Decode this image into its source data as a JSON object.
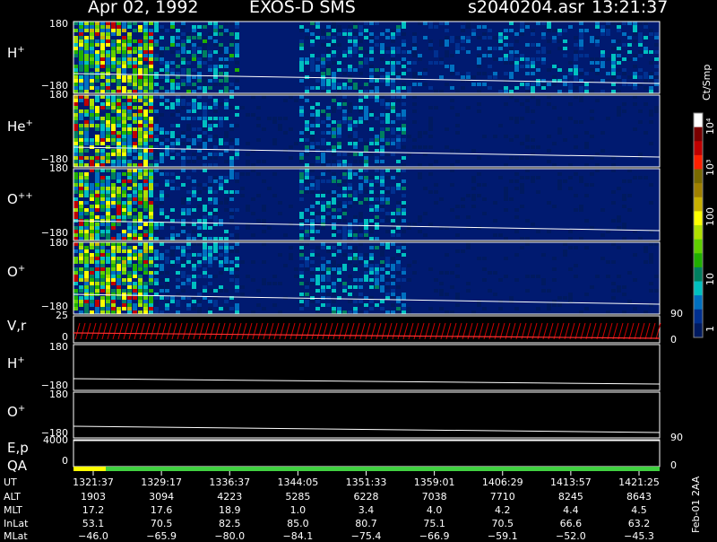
{
  "header": {
    "date": "Apr 02, 1992",
    "instrument": "EXOS-D SMS",
    "file": "s2040204.asr",
    "time": "13:21:37"
  },
  "panels": [
    {
      "label": "H",
      "sup": "+",
      "ytop": "180",
      "ybot": "−180"
    },
    {
      "label": "He",
      "sup": "+",
      "ytop": "180",
      "ybot": "−180"
    },
    {
      "label": "O",
      "sup": "++",
      "ytop": "180",
      "ybot": "−180"
    },
    {
      "label": "O",
      "sup": "+",
      "ytop": "180",
      "ybot": "−180"
    }
  ],
  "vr_panel": {
    "label": "V,r",
    "ytop": "25",
    "ybot": "0",
    "rtop": "90",
    "rbot": "0"
  },
  "h_line_panel": {
    "label": "H",
    "sup": "+",
    "ytop": "180",
    "ybot": "−180"
  },
  "o_line_panel": {
    "label": "O",
    "sup": "+",
    "ytop": "180",
    "ybot": "−180"
  },
  "ep_panel": {
    "label": "E,p",
    "ytop": "4000",
    "rtop": "90"
  },
  "qa_panel": {
    "label": "QA",
    "ybot": "0",
    "rbot": "0"
  },
  "colorbar": {
    "unit": "Ct/Smp",
    "ticks": [
      "10⁴",
      "10³",
      "100",
      "10",
      "1"
    ],
    "colors": [
      "#ffffff",
      "#7a0000",
      "#c00000",
      "#ff2000",
      "#7a6a00",
      "#a08000",
      "#c8b000",
      "#ffff00",
      "#b0e000",
      "#60d000",
      "#20b000",
      "#008060",
      "#00c0c0",
      "#0070c0",
      "#003090",
      "#001a60"
    ]
  },
  "side_text": "Feb-01 2AA",
  "table": {
    "labels": [
      "UT",
      "ALT",
      "MLT",
      "InLat",
      "MLat"
    ],
    "columns": [
      [
        "1321:37",
        "1903",
        "17.2",
        "53.1",
        "−46.0"
      ],
      [
        "1329:17",
        "3094",
        "17.6",
        "70.5",
        "−65.9"
      ],
      [
        "1336:37",
        "4223",
        "18.9",
        "82.5",
        "−80.0"
      ],
      [
        "1344:05",
        "5285",
        "1.0",
        "85.0",
        "−84.1"
      ],
      [
        "1351:33",
        "6228",
        "3.4",
        "80.7",
        "−75.4"
      ],
      [
        "1359:01",
        "7038",
        "4.0",
        "75.1",
        "−66.9"
      ],
      [
        "1406:29",
        "7710",
        "4.2",
        "70.5",
        "−59.1"
      ],
      [
        "1413:57",
        "8245",
        "4.4",
        "66.6",
        "−52.0"
      ],
      [
        "1421:25",
        "8643",
        "4.5",
        "63.2",
        "−45.3"
      ]
    ]
  },
  "chart_data": {
    "type": "heatmap",
    "title": "Apr 02, 1992   EXOS-D SMS",
    "x": [
      "1321:37",
      "1329:17",
      "1336:37",
      "1344:05",
      "1351:33",
      "1359:01",
      "1406:29",
      "1413:57",
      "1421:25"
    ],
    "xlabel": "UT",
    "series": [
      {
        "name": "H+",
        "ylim": [
          -180,
          180
        ]
      },
      {
        "name": "He+",
        "ylim": [
          -180,
          180
        ]
      },
      {
        "name": "O++",
        "ylim": [
          -180,
          180
        ]
      },
      {
        "name": "O+",
        "ylim": [
          -180,
          180
        ]
      }
    ],
    "colorbar_label": "Ct/Smp",
    "colorbar_range": [
      1,
      10000
    ],
    "colorbar_scale": "log"
  }
}
